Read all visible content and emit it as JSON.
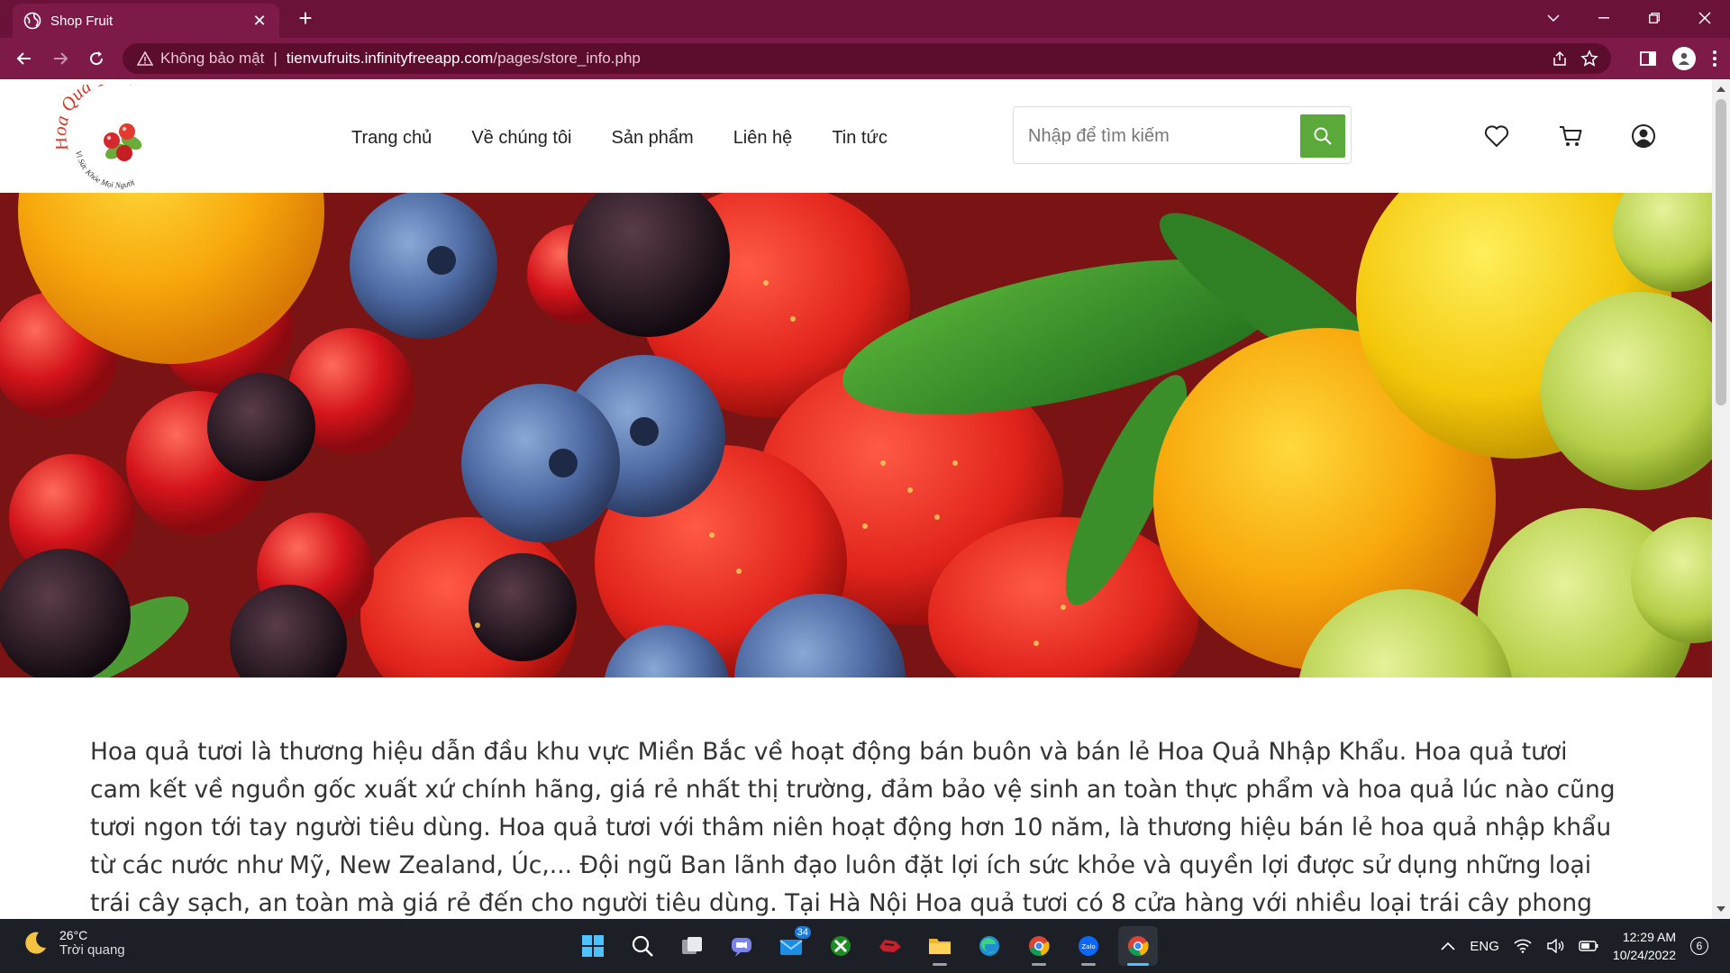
{
  "browser": {
    "tab_title": "Shop Fruit",
    "security_label": "Không bảo mật",
    "url_host": "tienvufruits.infinityfreeapp.com",
    "url_path": "/pages/store_info.php",
    "accent": "#7e1a47"
  },
  "site": {
    "logo_text": "Hoa Quả Tươi",
    "logo_tagline": "Vì Sức Khỏe Mọi Người",
    "nav": [
      "Trang chủ",
      "Về chúng tôi",
      "Sản phẩm",
      "Liên hệ",
      "Tin tức"
    ],
    "search_placeholder": "Nhập để tìm kiếm",
    "search_color": "#5aa93a",
    "about_text": "Hoa quả tươi là thương hiệu dẫn đầu khu vực Miền Bắc về hoạt động bán buôn và bán lẻ Hoa Quả Nhập Khẩu. Hoa quả tươi cam kết về nguồn gốc xuất xứ chính hãng, giá rẻ nhất thị trường, đảm bảo vệ sinh an toàn thực phẩm và hoa quả lúc nào cũng tươi ngon tới tay người tiêu dùng. Hoa quả tươi với thâm niên hoạt động hơn 10 năm, là thương hiệu bán lẻ hoa quả nhập khẩu từ các nước như Mỹ, New Zealand, Úc,... Đội ngũ Ban lãnh đạo luôn đặt lợi ích sức khỏe và quyền lợi được sử dụng những loại trái cây sạch, an toàn mà giá rẻ đến cho người tiêu dùng. Tại Hà Nội Hoa quả tươi có 8 cửa hàng với nhiều loại trái cây phong phú như lê, táo, cam, cherry, kiwi,..."
  },
  "taskbar": {
    "temperature": "26°C",
    "weather": "Trời quang",
    "mail_badge": "34",
    "language": "ENG",
    "time": "12:29 AM",
    "date": "10/24/2022",
    "notifications": "6"
  }
}
